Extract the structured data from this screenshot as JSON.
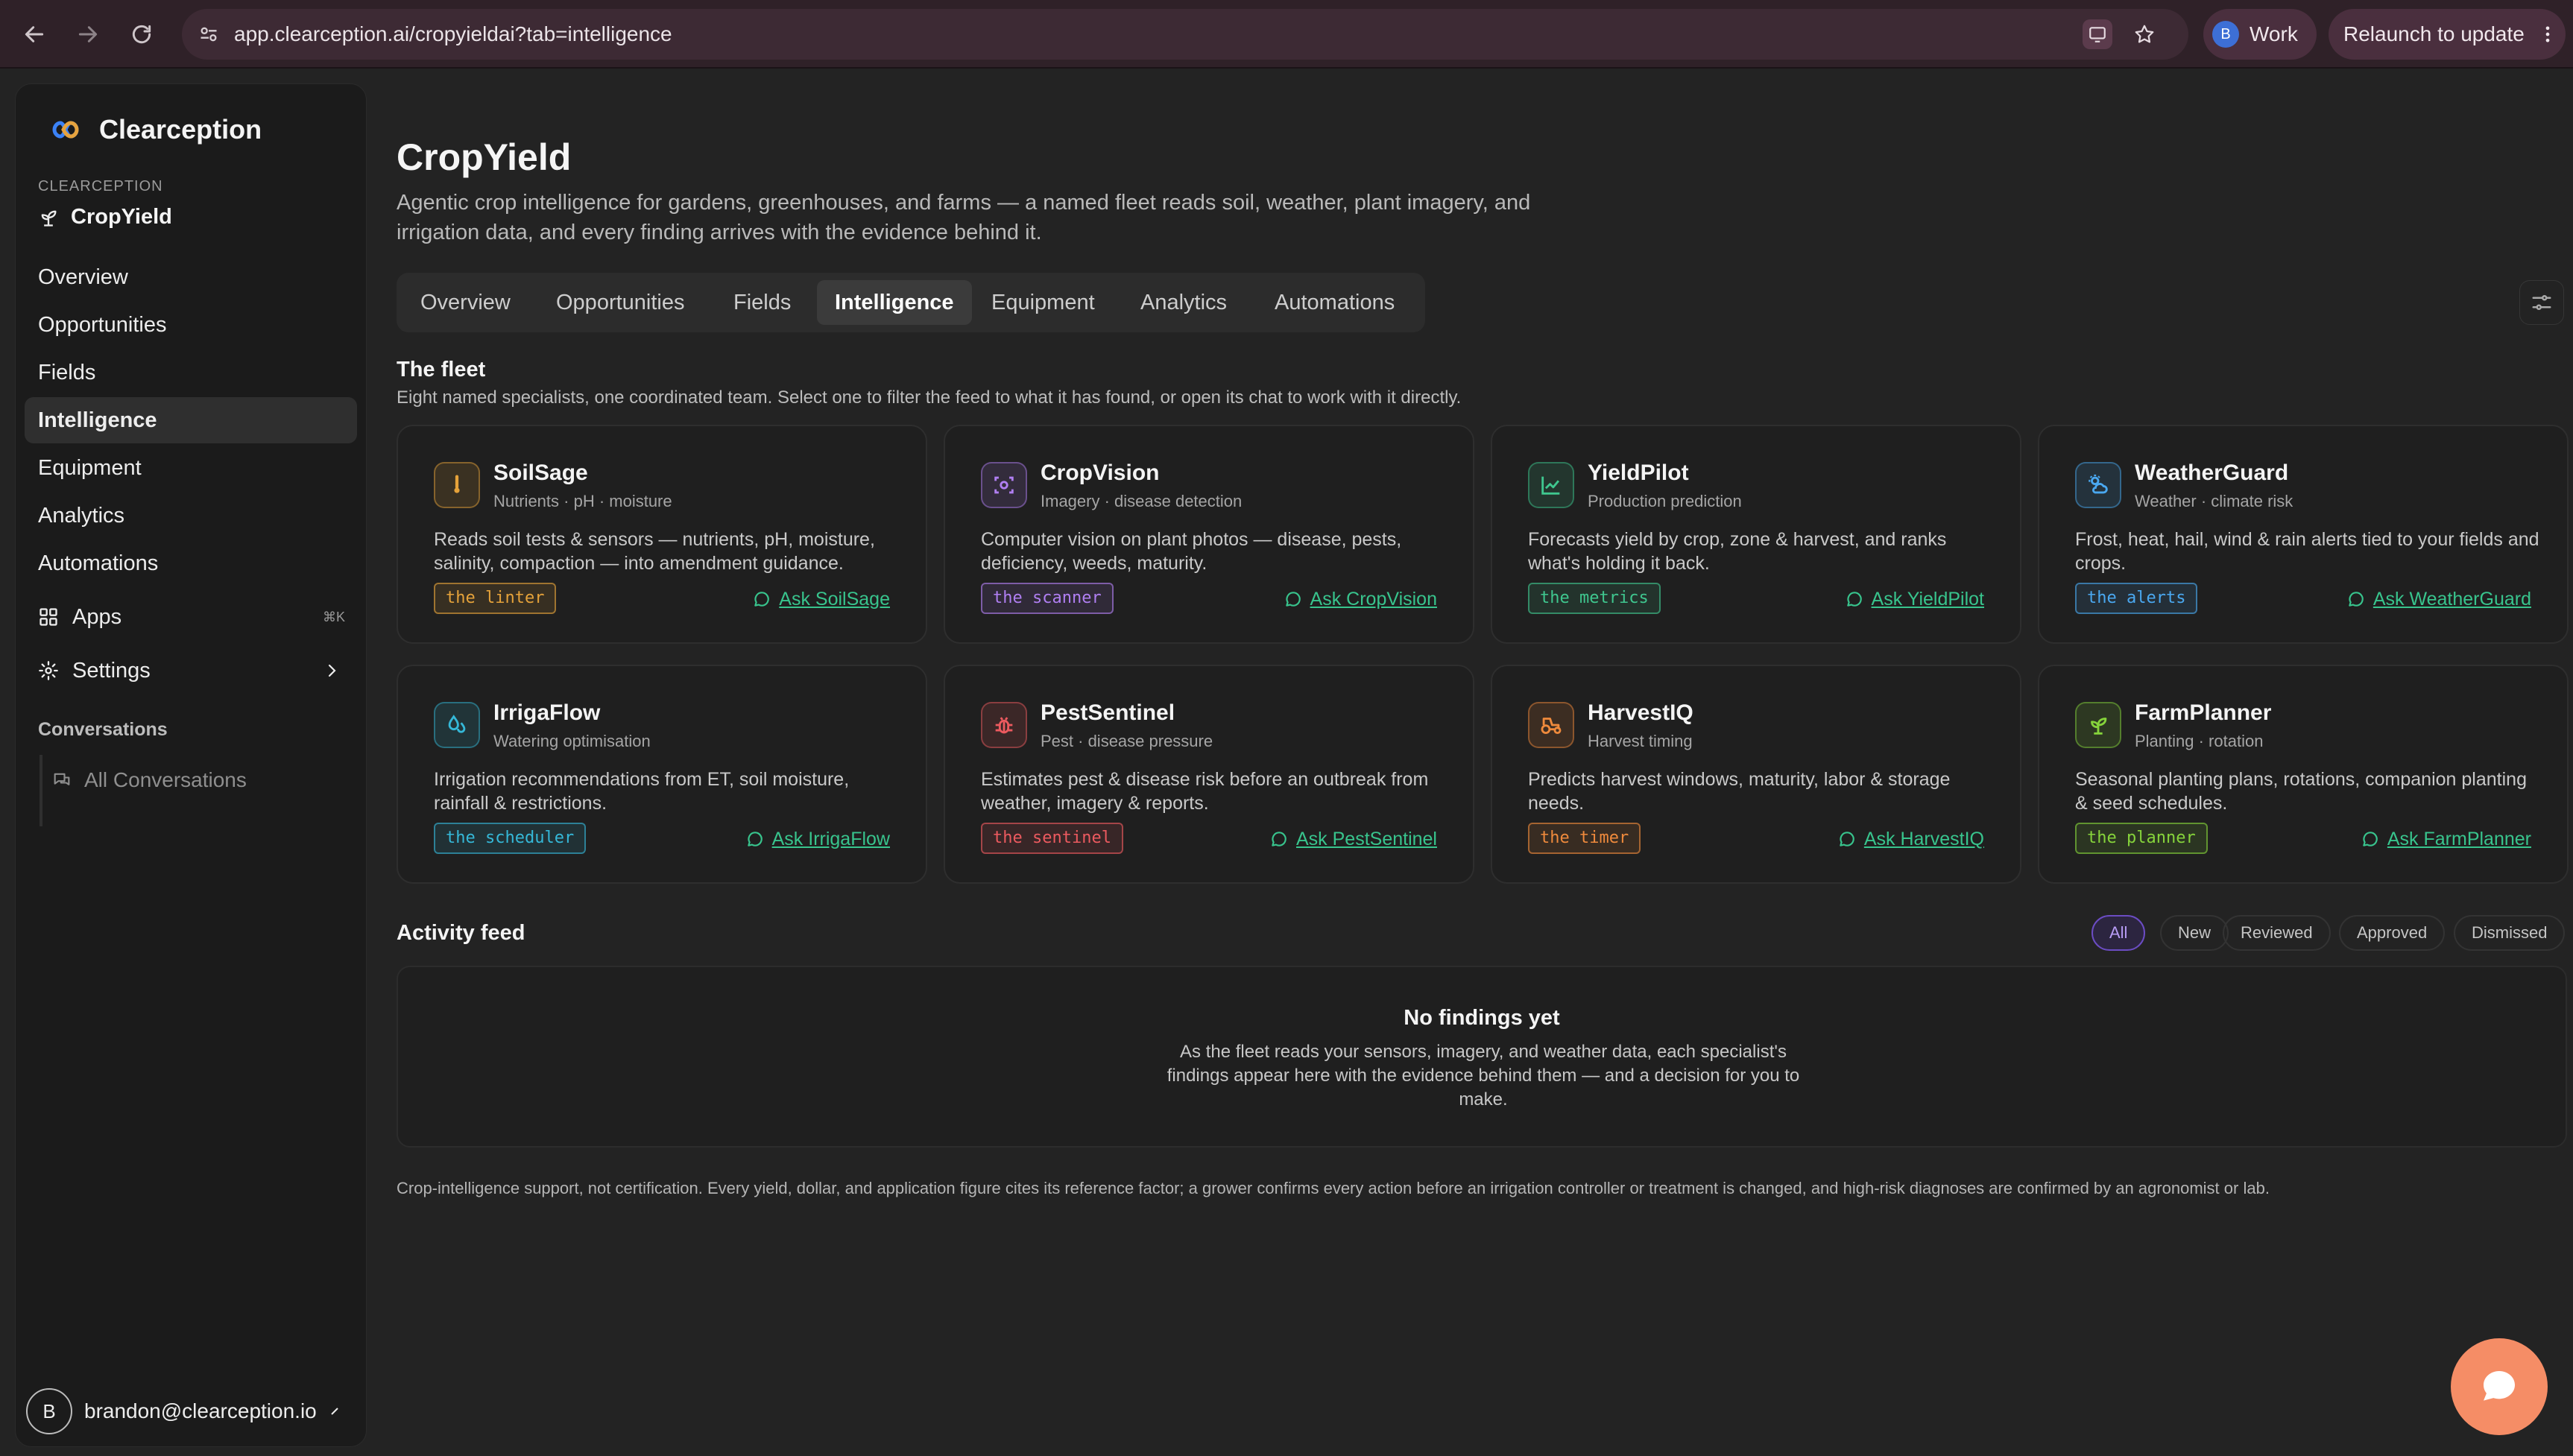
{
  "browser": {
    "url": "app.clearception.ai/cropyieldai?tab=intelligence",
    "profile_initial": "B",
    "profile_label": "Work",
    "relaunch_label": "Relaunch to update"
  },
  "sidebar": {
    "brand": "Clearception",
    "org_label": "CLEARCEPTION",
    "product": "CropYield",
    "nav": [
      {
        "label": "Overview"
      },
      {
        "label": "Opportunities"
      },
      {
        "label": "Fields"
      },
      {
        "label": "Intelligence"
      },
      {
        "label": "Equipment"
      },
      {
        "label": "Analytics"
      },
      {
        "label": "Automations"
      }
    ],
    "apps_label": "Apps",
    "apps_shortcut": "⌘K",
    "settings_label": "Settings",
    "conversations_label": "Conversations",
    "all_conversations_label": "All Conversations",
    "user_initial": "B",
    "user_email": "brandon@clearception.io"
  },
  "main": {
    "title": "CropYield",
    "subtitle": "Agentic crop intelligence for gardens, greenhouses, and farms — a named fleet reads soil, weather, plant imagery, and irrigation data, and every finding arrives with the evidence behind it.",
    "tabs": [
      {
        "label": "Overview"
      },
      {
        "label": "Opportunities"
      },
      {
        "label": "Fields"
      },
      {
        "label": "Intelligence"
      },
      {
        "label": "Equipment"
      },
      {
        "label": "Analytics"
      },
      {
        "label": "Automations"
      }
    ],
    "active_tab": "Intelligence",
    "fleet_title": "The fleet",
    "fleet_subtitle": "Eight named specialists, one coordinated team. Select one to filter the feed to what it has found, or open its chat to work with it directly.",
    "agents": [
      {
        "name": "SoilSage",
        "meta": "Nutrients · pH · moisture",
        "desc": "Reads soil tests & sensors — nutrients, pH, moisture, salinity, compaction — into amendment guidance.",
        "tag": "the linter",
        "ask": "Ask SoilSage",
        "icon": "thermometer-icon",
        "color": "#e5a23a"
      },
      {
        "name": "CropVision",
        "meta": "Imagery · disease detection",
        "desc": "Computer vision on plant photos — disease, pests, deficiency, weeds, maturity.",
        "tag": "the scanner",
        "ask": "Ask CropVision",
        "icon": "scan-eye-icon",
        "color": "#b07ff2"
      },
      {
        "name": "YieldPilot",
        "meta": "Production prediction",
        "desc": "Forecasts yield by crop, zone & harvest, and ranks what's holding it back.",
        "tag": "the metrics",
        "ask": "Ask YieldPilot",
        "icon": "line-chart-icon",
        "color": "#3fc78f"
      },
      {
        "name": "WeatherGuard",
        "meta": "Weather · climate risk",
        "desc": "Frost, heat, hail, wind & rain alerts tied to your fields and crops.",
        "tag": "the alerts",
        "ask": "Ask WeatherGuard",
        "icon": "cloud-sun-icon",
        "color": "#4aa8f0"
      },
      {
        "name": "IrrigaFlow",
        "meta": "Watering optimisation",
        "desc": "Irrigation recommendations from ET, soil moisture, rainfall & restrictions.",
        "tag": "the scheduler",
        "ask": "Ask IrrigaFlow",
        "icon": "droplets-icon",
        "color": "#35b8d8"
      },
      {
        "name": "PestSentinel",
        "meta": "Pest · disease pressure",
        "desc": "Estimates pest & disease risk before an outbreak from weather, imagery & reports.",
        "tag": "the sentinel",
        "ask": "Ask PestSentinel",
        "icon": "bug-icon",
        "color": "#ec5a5f"
      },
      {
        "name": "HarvestIQ",
        "meta": "Harvest timing",
        "desc": "Predicts harvest windows, maturity, labor & storage needs.",
        "tag": "the timer",
        "ask": "Ask HarvestIQ",
        "icon": "tractor-icon",
        "color": "#ef8a3c"
      },
      {
        "name": "FarmPlanner",
        "meta": "Planting · rotation",
        "desc": "Seasonal planting plans, rotations, companion planting & seed schedules.",
        "tag": "the planner",
        "ask": "Ask FarmPlanner",
        "icon": "sprout-icon",
        "color": "#86d43b"
      }
    ],
    "feed_title": "Activity feed",
    "feed_filters": [
      {
        "label": "All"
      },
      {
        "label": "New"
      },
      {
        "label": "Reviewed"
      },
      {
        "label": "Approved"
      },
      {
        "label": "Dismissed"
      }
    ],
    "empty_title": "No findings yet",
    "empty_desc": "As the fleet reads your sensors, imagery, and weather data, each specialist's findings appear here with the evidence behind them — and a decision for you to make.",
    "footer_note": "Crop-intelligence support, not certification. Every yield, dollar, and application figure cites its reference factor; a grower confirms every action before an irrigation controller or treatment is changed, and high-risk diagnoses are confirmed by an agronomist or lab."
  },
  "colors": {
    "accent_green": "#38c48d",
    "accent_purple": "#6b4cc3",
    "fab_orange": "#f58d66",
    "chrome_bg": "#2f2128"
  }
}
